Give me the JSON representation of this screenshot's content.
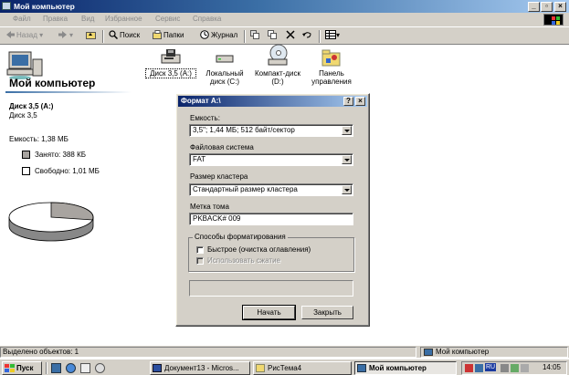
{
  "window": {
    "title": "Мой компьютер",
    "controls": [
      "_",
      "▫",
      "×"
    ]
  },
  "menu": [
    "Файл",
    "Правка",
    "Вид",
    "Избранное",
    "Сервис",
    "Справка"
  ],
  "toolbar": {
    "back": "Назад",
    "search": "Поиск",
    "folders": "Папки",
    "history": "Журнал"
  },
  "left_pane": {
    "title": "Мой компьютер",
    "drive_title": "Диск 3,5 (A:)",
    "drive_sub": "Диск 3,5",
    "capacity": "Емкость: 1,38 МБ",
    "used": "Занято: 388 КБ",
    "free": "Свободно: 1,01 МБ",
    "used_fraction": 0.28
  },
  "drives": [
    {
      "line1": "Диск 3,5 (A:)",
      "line2": ""
    },
    {
      "line1": "Локальный",
      "line2": "диск (C:)"
    },
    {
      "line1": "Компакт-диск",
      "line2": "(D:)"
    },
    {
      "line1": "Панель",
      "line2": "управления"
    }
  ],
  "dialog": {
    "title": "Формат A:\\",
    "help_btn": "?",
    "close_btn": "×",
    "capacity_label": "Емкость:",
    "capacity_value": "3,5\"; 1,44 МБ; 512 байт/сектор",
    "fs_label": "Файловая система",
    "fs_value": "FAT",
    "cluster_label": "Размер кластера",
    "cluster_value": "Стандартный размер кластера",
    "volume_label": "Метка тома",
    "volume_value": "PKBACK# 009",
    "options_title": "Способы форматирования",
    "quick_format": "Быстрое (очистка оглавления)",
    "compression": "Использовать сжатие",
    "start_btn": "Начать",
    "close_label": "Закрыть"
  },
  "status": {
    "selected": "Выделено объектов: 1",
    "location": "Мой компьютер"
  },
  "taskbar": {
    "start": "Пуск",
    "tasks": [
      "Документ13 - Micros...",
      "РисТема4",
      "Мой компьютер"
    ],
    "lang": "RU",
    "clock": "14:05"
  }
}
